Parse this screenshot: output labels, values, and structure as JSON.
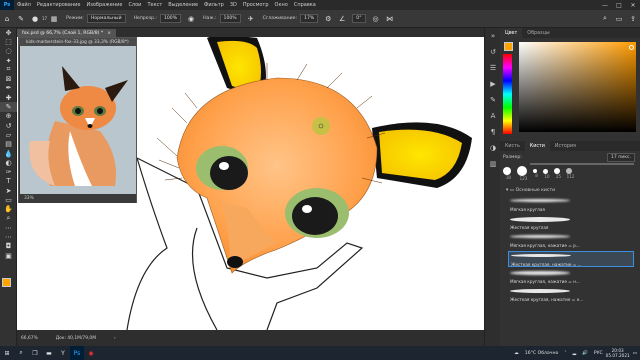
{
  "menubar": {
    "app_icon": "Ps",
    "items": [
      "Файл",
      "Редактирование",
      "Изображение",
      "Слои",
      "Текст",
      "Выделение",
      "Фильтр",
      "3D",
      "Просмотр",
      "Окно",
      "Справка"
    ]
  },
  "options": {
    "brush_size": "17",
    "mode_label": "Режим:",
    "mode_value": "Нормальный",
    "opacity_label": "Непрозр.:",
    "opacity_value": "100%",
    "flow_label": "Наж.:",
    "flow_value": "100%",
    "smooth_label": "Сглаживание:",
    "smooth_value": "17%",
    "angle_value": "0°"
  },
  "tab": {
    "title": "fox.psd @ 66,7% (Слой 1, RGB/8) *",
    "close": "×"
  },
  "docwin": {
    "title": "kids-marberstein-fox-33.jpg @ 33,3% (RGB/8*)",
    "zoom": "33%"
  },
  "status": {
    "zoom": "66,67%",
    "doc": "Док: 40,1M/79,0M"
  },
  "panels": {
    "color_tab": "Цвет",
    "swatches_tab": "Образцы",
    "brushes_tab": "Кисти",
    "presets_tab": "Кисть",
    "history_tab": "История",
    "size_label": "Размер:",
    "size_value": "17 пикс.",
    "folder_label": "Основные кисти",
    "brush_numbers": [
      "30",
      "123",
      "8",
      "10",
      "25",
      "112"
    ],
    "brushes": [
      "Мягкая круглая",
      "Жесткая круглая",
      "Мягкая круглая, нажатие = р...",
      "Жесткая круглая, нажатие = ...",
      "Мягкая круглая, нажатие = н...",
      "Жесткая круглая, нажатие = н..."
    ]
  },
  "colors": {
    "foreground": "#ffa400",
    "background": "#ffffff",
    "accent": "#3c8ee0"
  },
  "taskbar": {
    "weather": "16°C Облачно",
    "lang": "РУС",
    "time": "20:03",
    "date": "05.07.2021"
  }
}
